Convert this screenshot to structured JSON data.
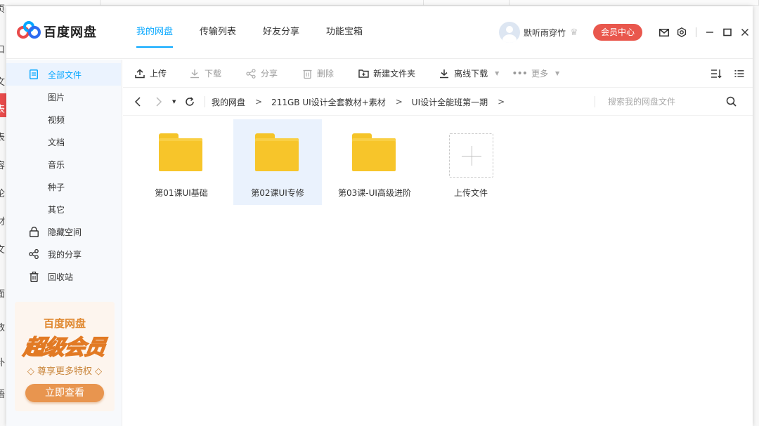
{
  "background": {
    "side_chars": [
      "页",
      "口",
      "文",
      "表",
      "表",
      "容",
      "论",
      "材",
      "文",
      "面",
      "数",
      "补",
      "语"
    ]
  },
  "header": {
    "logo_text": "百度网盘",
    "nav": [
      {
        "label": "我的网盘",
        "active": true
      },
      {
        "label": "传输列表",
        "active": false
      },
      {
        "label": "好友分享",
        "active": false
      },
      {
        "label": "功能宝箱",
        "active": false
      }
    ],
    "username": "默听雨穿竹",
    "vip_button": "会员中心"
  },
  "sidebar": {
    "items": [
      {
        "label": "全部文件",
        "icon": "document-icon",
        "active": true
      },
      {
        "label": "图片"
      },
      {
        "label": "视频"
      },
      {
        "label": "文档"
      },
      {
        "label": "音乐"
      },
      {
        "label": "种子"
      },
      {
        "label": "其它"
      },
      {
        "label": "隐藏空间",
        "icon": "lock-icon"
      },
      {
        "label": "我的分享",
        "icon": "share-icon"
      },
      {
        "label": "回收站",
        "icon": "trash-icon"
      }
    ],
    "promo": {
      "title": "百度网盘",
      "big_text": "超级会员",
      "subtitle": "◇ 尊享更多特权 ◇",
      "button": "立即查看"
    }
  },
  "toolbar": {
    "upload": "上传",
    "download": "下载",
    "share": "分享",
    "delete": "删除",
    "new_folder": "新建文件夹",
    "offline_download": "离线下载",
    "more": "更多"
  },
  "pathbar": {
    "crumbs": [
      "我的网盘",
      "211GB UI设计全套教材+素材",
      "UI设计全能班第一期"
    ],
    "search_placeholder": "搜索我的网盘文件"
  },
  "files": [
    {
      "name": "第01课UI基础",
      "type": "folder",
      "selected": false
    },
    {
      "name": "第02课UI专修",
      "type": "folder",
      "selected": true
    },
    {
      "name": "第03课-UI高级进阶",
      "type": "folder",
      "selected": false
    },
    {
      "name": "上传文件",
      "type": "upload",
      "selected": false
    }
  ],
  "colors": {
    "accent": "#06a7ff",
    "vip": "#e9574d",
    "folder": "#f7c52a"
  }
}
